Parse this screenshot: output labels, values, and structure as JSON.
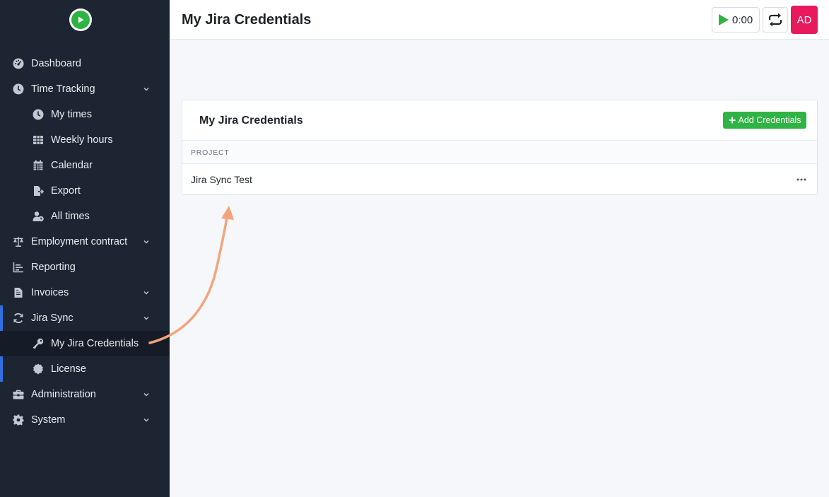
{
  "header": {
    "title": "My Jira Credentials",
    "timer": "0:00",
    "avatar_initials": "AD"
  },
  "sidebar": {
    "items": [
      {
        "label": "Dashboard",
        "icon": "dashboard-icon"
      },
      {
        "label": "Time Tracking",
        "icon": "clock-icon",
        "expandable": true
      },
      {
        "label": "My times",
        "icon": "clock-icon",
        "sub": true
      },
      {
        "label": "Weekly hours",
        "icon": "table-icon",
        "sub": true
      },
      {
        "label": "Calendar",
        "icon": "calendar-icon",
        "sub": true
      },
      {
        "label": "Export",
        "icon": "export-icon",
        "sub": true
      },
      {
        "label": "All times",
        "icon": "users-clock-icon",
        "sub": true
      },
      {
        "label": "Employment contract",
        "icon": "scale-icon",
        "expandable": true
      },
      {
        "label": "Reporting",
        "icon": "chart-icon"
      },
      {
        "label": "Invoices",
        "icon": "file-invoice-icon",
        "expandable": true
      },
      {
        "label": "Jira Sync",
        "icon": "sync-icon",
        "expandable": true
      },
      {
        "label": "My Jira Credentials",
        "icon": "key-icon",
        "sub": true,
        "active": true
      },
      {
        "label": "License",
        "icon": "badge-icon",
        "sub": true
      },
      {
        "label": "Administration",
        "icon": "toolbox-icon",
        "expandable": true
      },
      {
        "label": "System",
        "icon": "gear-icon",
        "expandable": true
      }
    ]
  },
  "card": {
    "title": "My Jira Credentials",
    "add_label": "Add Credentials",
    "columns": [
      "PROJECT"
    ],
    "rows": [
      {
        "project": "Jira Sync Test"
      }
    ]
  },
  "colors": {
    "sidebar_bg": "#1d2532",
    "accent_green": "#2fb344",
    "avatar_pink": "#e8195d",
    "active_bar": "#2f6fdf",
    "arrow": "#f4a47c"
  }
}
